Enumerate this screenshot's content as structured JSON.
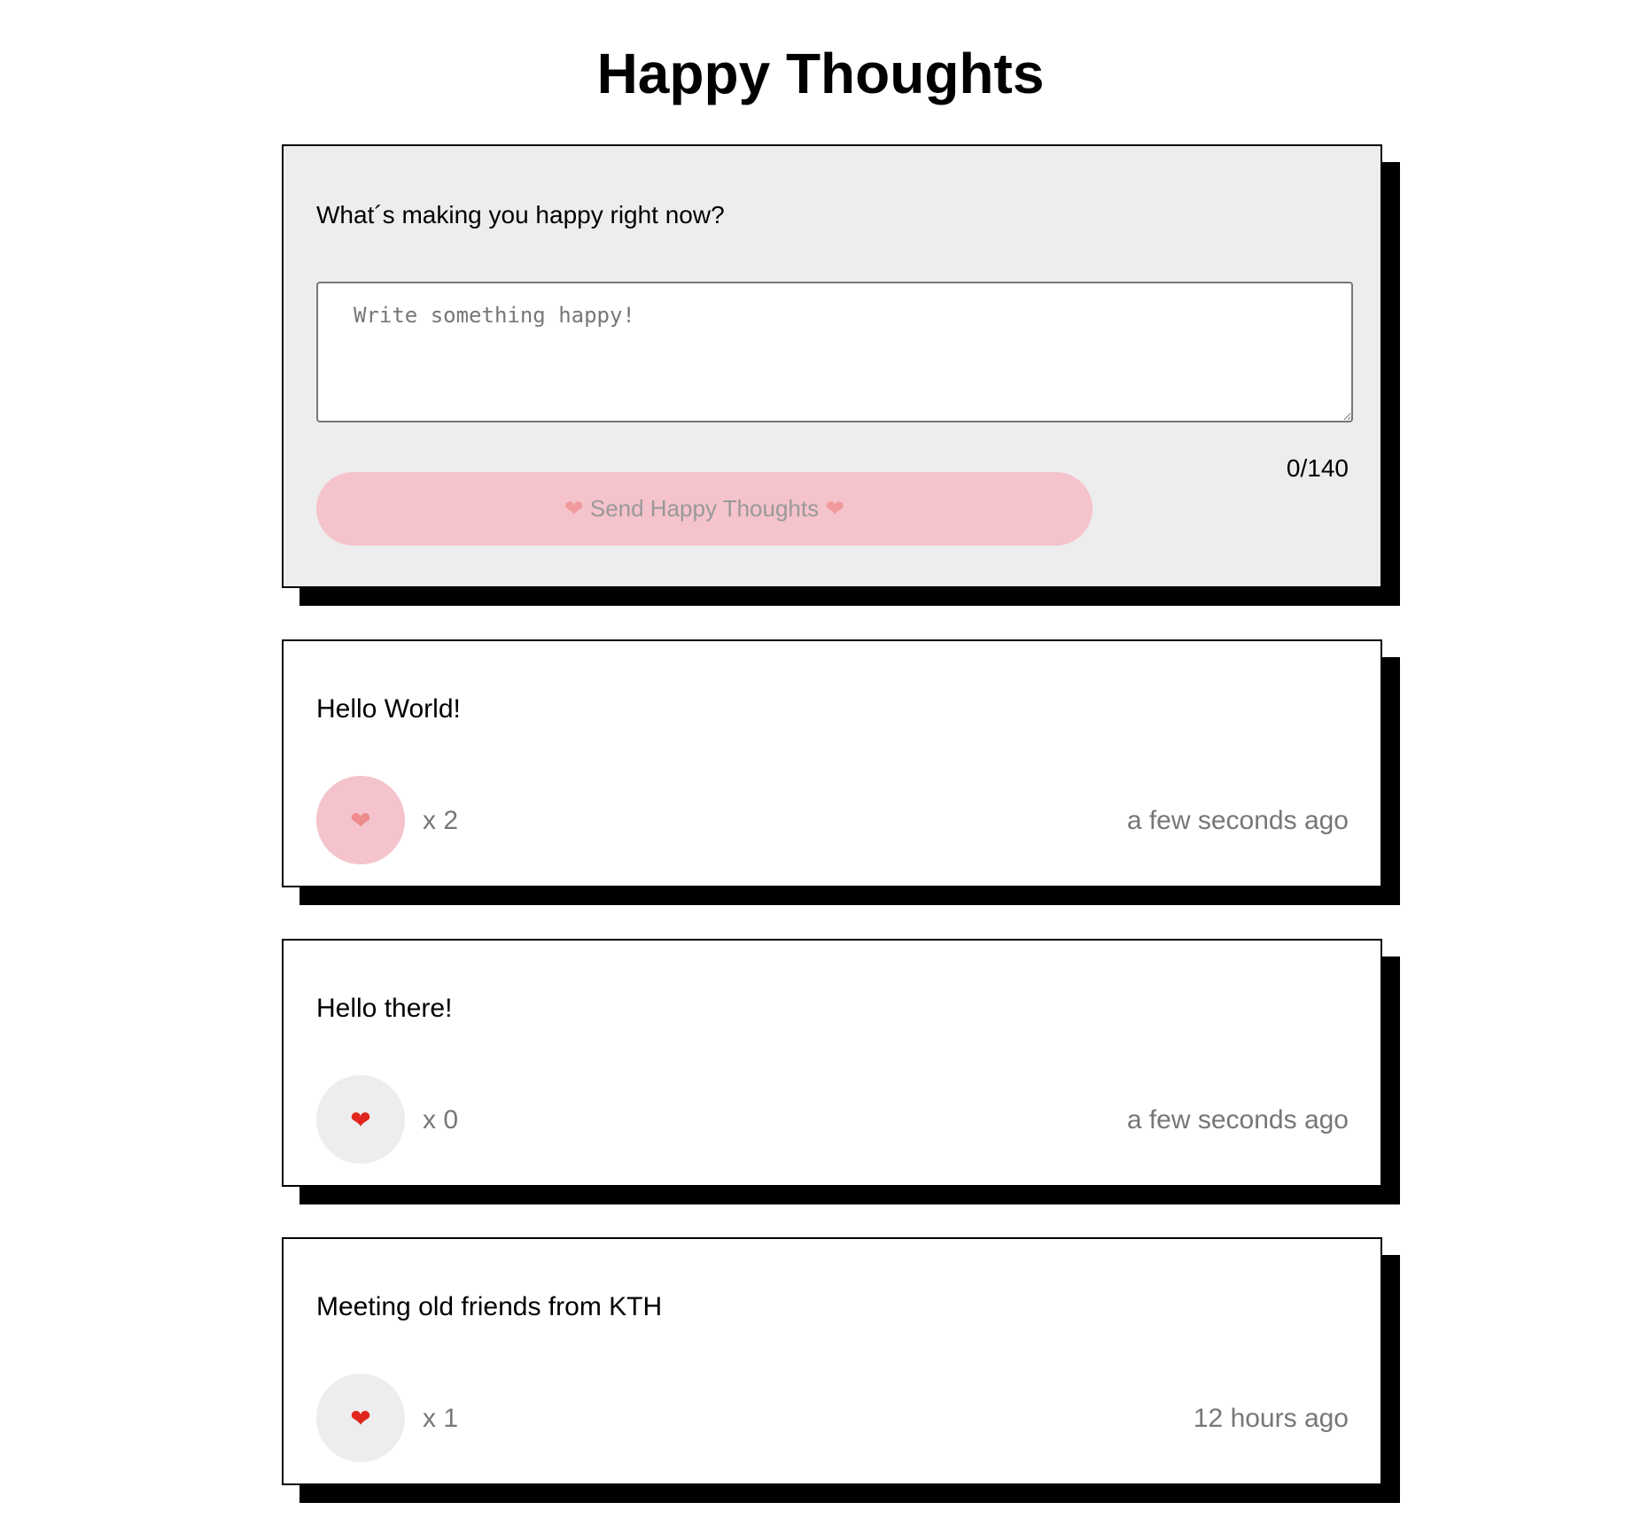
{
  "header": {
    "title": "Happy Thoughts"
  },
  "form": {
    "label": "What´s making you happy right now?",
    "placeholder": "Write something happy!",
    "value": "",
    "counter": "0/140",
    "send_heart": "❤",
    "send_label": "Send Happy Thoughts"
  },
  "thoughts": [
    {
      "message": "Hello World!",
      "heart": "❤",
      "likes": "x 2",
      "time": "a few seconds ago",
      "liked": true
    },
    {
      "message": "Hello there!",
      "heart": "❤",
      "likes": "x 0",
      "time": "a few seconds ago",
      "liked": false
    },
    {
      "message": "Meeting old friends from KTH",
      "heart": "❤",
      "likes": "x 1",
      "time": "12 hours ago",
      "liked": false
    }
  ],
  "colors": {
    "form_bg": "#ededed",
    "liked_bg": "#f5c3cb",
    "heart": "#e0261c",
    "muted_text": "#777777"
  }
}
